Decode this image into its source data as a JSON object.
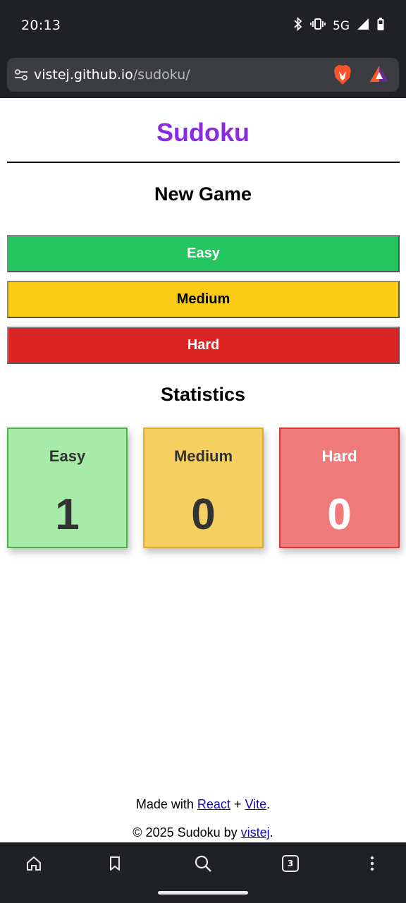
{
  "status_bar": {
    "time": "20:13",
    "network": "5G",
    "icons": [
      "bluetooth-icon",
      "vibrate-icon",
      "signal-icon",
      "battery-icon"
    ]
  },
  "browser": {
    "url_host": "vistej.github.io",
    "url_path": "/sudoku/",
    "tab_count": "3",
    "toolbar_icons": [
      "home-icon",
      "bookmark-icon",
      "search-icon",
      "tabs-icon",
      "more-vert-icon"
    ]
  },
  "page": {
    "title": "Sudoku",
    "new_game_heading": "New Game",
    "buttons": {
      "easy": "Easy",
      "medium": "Medium",
      "hard": "Hard"
    },
    "statistics_heading": "Statistics",
    "stats": [
      {
        "label": "Easy",
        "value": "1"
      },
      {
        "label": "Medium",
        "value": "0"
      },
      {
        "label": "Hard",
        "value": "0"
      }
    ],
    "footer": {
      "made_with_prefix": "Made with ",
      "react_link": "React",
      "plus": " + ",
      "vite_link": "Vite",
      "made_suffix": ".",
      "copyright_prefix": "© 2025 Sudoku by ",
      "author_link": "vistej",
      "copyright_suffix": "."
    }
  },
  "colors": {
    "title": "#8a2be2",
    "easy": "#22c55e",
    "medium": "#facc15",
    "hard": "#dc2626",
    "link": "#1a0dab"
  }
}
